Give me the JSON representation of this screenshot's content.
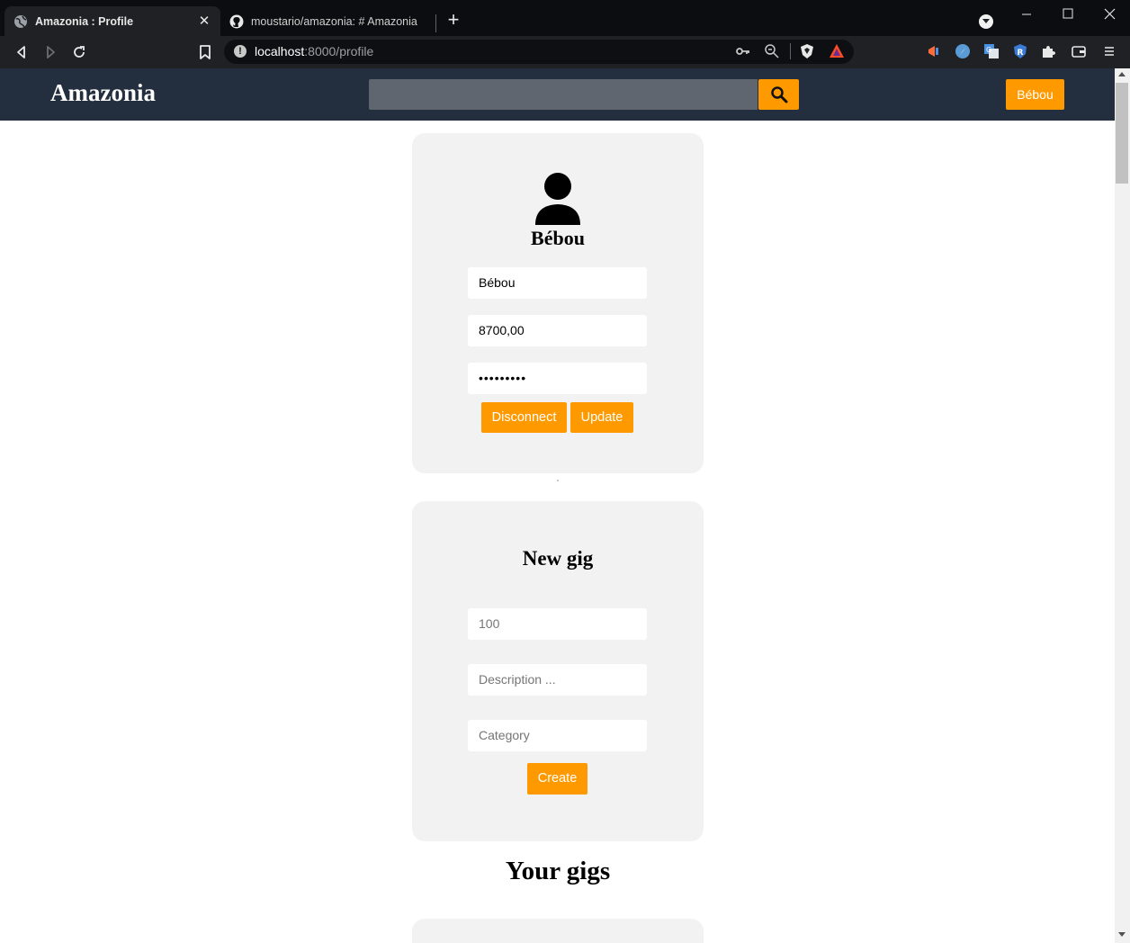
{
  "browser": {
    "tabs": [
      {
        "title": "Amazonia : Profile",
        "active": true
      },
      {
        "title": "moustario/amazonia: # Amazonia",
        "active": false
      }
    ],
    "url_host": "localhost",
    "url_path": ":8000/profile"
  },
  "header": {
    "brand": "Amazonia",
    "search_value": "",
    "user_label": "Bébou"
  },
  "profile": {
    "name": "Bébou",
    "username_value": "Bébou",
    "balance_value": "8700,00",
    "password_value": "•••••••••",
    "disconnect_label": "Disconnect",
    "update_label": "Update"
  },
  "new_gig": {
    "title": "New gig",
    "price_placeholder": "100",
    "description_placeholder": "Description ...",
    "category_placeholder": "Category",
    "create_label": "Create"
  },
  "gigs": {
    "title": "Your gigs"
  },
  "colors": {
    "accent": "#ff9900",
    "header_bg": "#232f3e",
    "card_bg": "#f2f2f2"
  },
  "icons": [
    "globe-icon",
    "github-icon",
    "search-icon",
    "user-icon",
    "back-icon",
    "forward-icon",
    "reload-icon",
    "bookmark-icon",
    "key-icon",
    "zoom-icon",
    "brave-shield-icon",
    "brave-rewards-icon",
    "puzzle-icon",
    "wallet-icon",
    "menu-icon"
  ]
}
